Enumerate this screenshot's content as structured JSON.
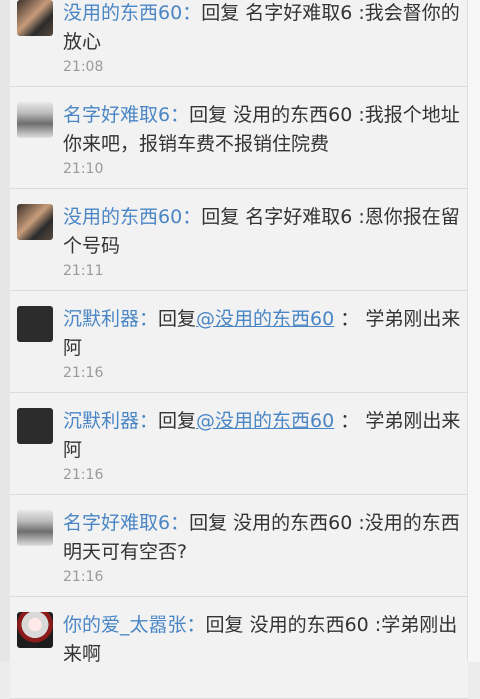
{
  "comments": [
    {
      "author": "没用的东西60",
      "colon": "：",
      "reply_prefix": "回复 ",
      "reply_to": "名字好难取6",
      "text": " :我会督你的放心",
      "time": "21:08",
      "avatar": "selfie-avatar"
    },
    {
      "author": "名字好难取6",
      "colon": "：",
      "reply_prefix": "回复 ",
      "reply_to": "没用的东西60",
      "text": " :我报个地址你来吧，报销车费不报销住院费",
      "time": "21:10",
      "avatar": "abs-avatar"
    },
    {
      "author": "没用的东西60",
      "colon": "：",
      "reply_prefix": "回复 ",
      "reply_to": "名字好难取6",
      "text": " :恩你报在留个号码",
      "time": "21:11",
      "avatar": "selfie-avatar"
    },
    {
      "author": "沉默利器",
      "colon": "：",
      "reply_prefix": "回复",
      "mention": "@没用的东西60",
      "text": " ： 学弟刚出来阿",
      "time": "21:16",
      "avatar": "mascot-avatar"
    },
    {
      "author": "沉默利器",
      "colon": "：",
      "reply_prefix": "回复",
      "mention": "@没用的东西60",
      "text": " ： 学弟刚出来阿",
      "time": "21:16",
      "avatar": "mascot-avatar"
    },
    {
      "author": "名字好难取6",
      "colon": "：",
      "reply_prefix": "回复 ",
      "reply_to": "没用的东西60",
      "text": " :没用的东西 明天可有空否?",
      "time": "21:16",
      "avatar": "abs-avatar"
    },
    {
      "author": "你的爱_太嚣张",
      "colon": "：",
      "reply_prefix": "回复 ",
      "reply_to": "没用的东西60",
      "text": " :学弟刚出来啊",
      "time": "",
      "avatar": "rose-avatar"
    }
  ]
}
